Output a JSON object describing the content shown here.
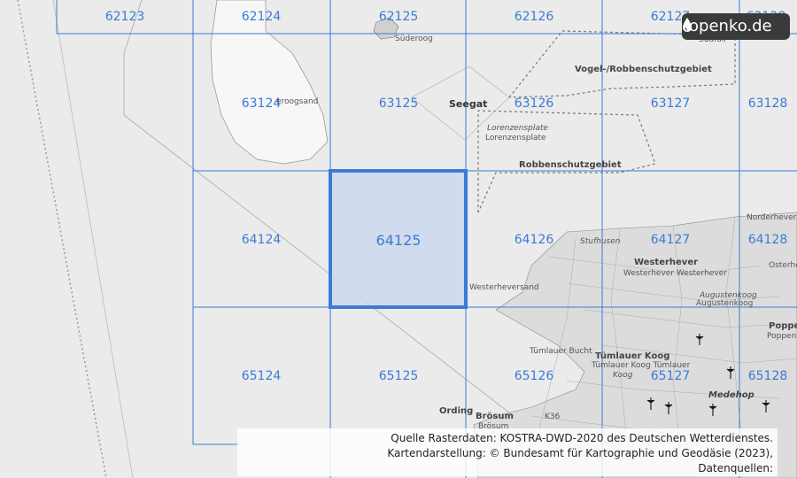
{
  "logo": {
    "text": "openko.de"
  },
  "grid": {
    "highlight_cell": "64125",
    "line_color": "#3a7bd5",
    "highlight_fill": "#cdd8ee",
    "rows": [
      [
        "62123",
        "62124",
        "62125",
        "62126",
        "62127",
        "62128"
      ],
      [
        "63124",
        "63125",
        "63126",
        "63127",
        "63128"
      ],
      [
        "64124",
        "64125",
        "64126",
        "64127",
        "64128"
      ],
      [
        "65124",
        "65125",
        "65126",
        "65127",
        "65128"
      ]
    ]
  },
  "places": {
    "suederoog": "Süderoog",
    "suedfall": "Südfall",
    "vogel": "Vogel-/Robbenschutzgebiet",
    "seegat": "Seegat",
    "eroogsand": "eroogsand",
    "lorenzensplate_1": "Lorenzensplate",
    "lorenzensplate_2": "Lorenzensplate",
    "robbenschutz": "Robbenschutzgebiet",
    "stufhusen": "Stufhusen",
    "westerhever": "Westerhever",
    "westerhever_2": "Westerhever Westerhever",
    "westerheversand": "Westerheversand",
    "augustenkoog": "Augustenkoog",
    "augustenkoog_2": "Augustenkoog",
    "norderheverkoog": "Norderheverkoog",
    "oesterhever": "Osterhe",
    "tuemlauer_koog": "Tümlauer Koog",
    "tuemlauer_koog_2": "Tümlauer Koog Tümlauer",
    "tuemlauer_bucht": "Tümlauer Bucht",
    "koog": "Koog",
    "ording": "Ording",
    "broesum": "Brösum",
    "broesum_2": "Brösum",
    "k36": "K36",
    "medehop": "Medehop",
    "poppenbuell": "Poppe",
    "poppenbuell_2": "Poppenbül"
  },
  "attribution": {
    "line1": "Quelle Rasterdaten: KOSTRA-DWD-2020 des Deutschen Wetterdienstes.",
    "line2": "Kartendarstellung: © Bundesamt für Kartographie und Geodäsie (2023),",
    "line3": "Datenquellen: https://sgx.geodatenzentrum.de/web_public/gdz/datenquellen/Datenquellen_TopPlusOpen.html"
  }
}
